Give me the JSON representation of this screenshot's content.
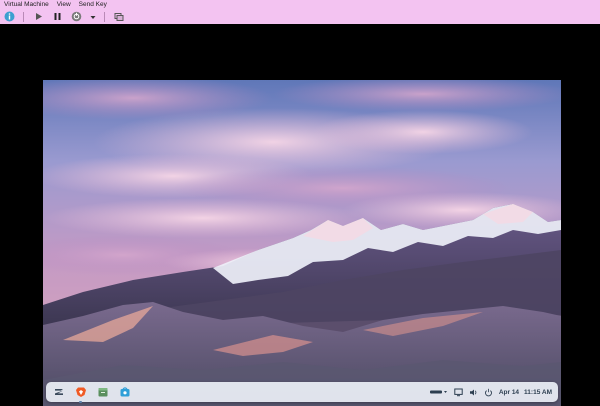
{
  "host": {
    "menu": [
      "Virtual Machine",
      "View",
      "Send Key"
    ],
    "toolbar_icons": [
      "info-icon",
      "play-icon",
      "pause-icon",
      "power-icon",
      "dropdown-arrow-icon",
      "screenshot-icon"
    ]
  },
  "guest": {
    "taskbar": {
      "apps": [
        "zorin-menu-icon",
        "brave-browser-icon",
        "files-icon",
        "software-store-icon"
      ],
      "tray_icons": [
        "keyboard-layout-icon",
        "display-icon",
        "volume-icon",
        "power-icon"
      ],
      "date": "Apr 14",
      "time": "11:15 AM"
    }
  },
  "colors": {
    "host_chrome": "#f3c3f1",
    "vm_border": "#000000",
    "taskbar": "#ecf0f6",
    "accent": "#4a90d9"
  }
}
